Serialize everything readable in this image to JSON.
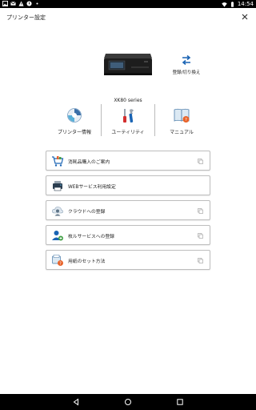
{
  "status_bar": {
    "time": "14:54",
    "icons": [
      "image-icon",
      "mail-icon",
      "warning-icon",
      "notification-icon",
      "dots-icon",
      "wifi-icon",
      "battery-icon"
    ]
  },
  "header": {
    "title": "プリンター設定",
    "close_icon": "close-icon"
  },
  "printer": {
    "name": "XK80 series"
  },
  "switch_printer": {
    "label": "登録/切り換え",
    "icon": "swap-arrows-icon"
  },
  "tools": [
    {
      "label": "プリンター情報",
      "icon": "printer-info-icon"
    },
    {
      "label": "ユーティリティ",
      "icon": "utility-tools-icon"
    },
    {
      "label": "マニュアル",
      "icon": "manual-book-icon"
    }
  ],
  "menu": [
    {
      "label": "消耗品購入のご案内",
      "icon": "cart-icon"
    },
    {
      "label": "WEBサービス利用設定",
      "icon": "printer-web-icon"
    },
    {
      "label": "クラウドへの登録",
      "icon": "cloud-user-icon"
    },
    {
      "label": "枚ルサービスへの登録",
      "icon": "user-add-icon"
    },
    {
      "label": "用紙のセット方法",
      "icon": "paper-help-icon"
    }
  ],
  "colors": {
    "accent_blue": "#1a64b4",
    "menu_border": "#bdbdbd",
    "help_orange": "#e8632a"
  }
}
